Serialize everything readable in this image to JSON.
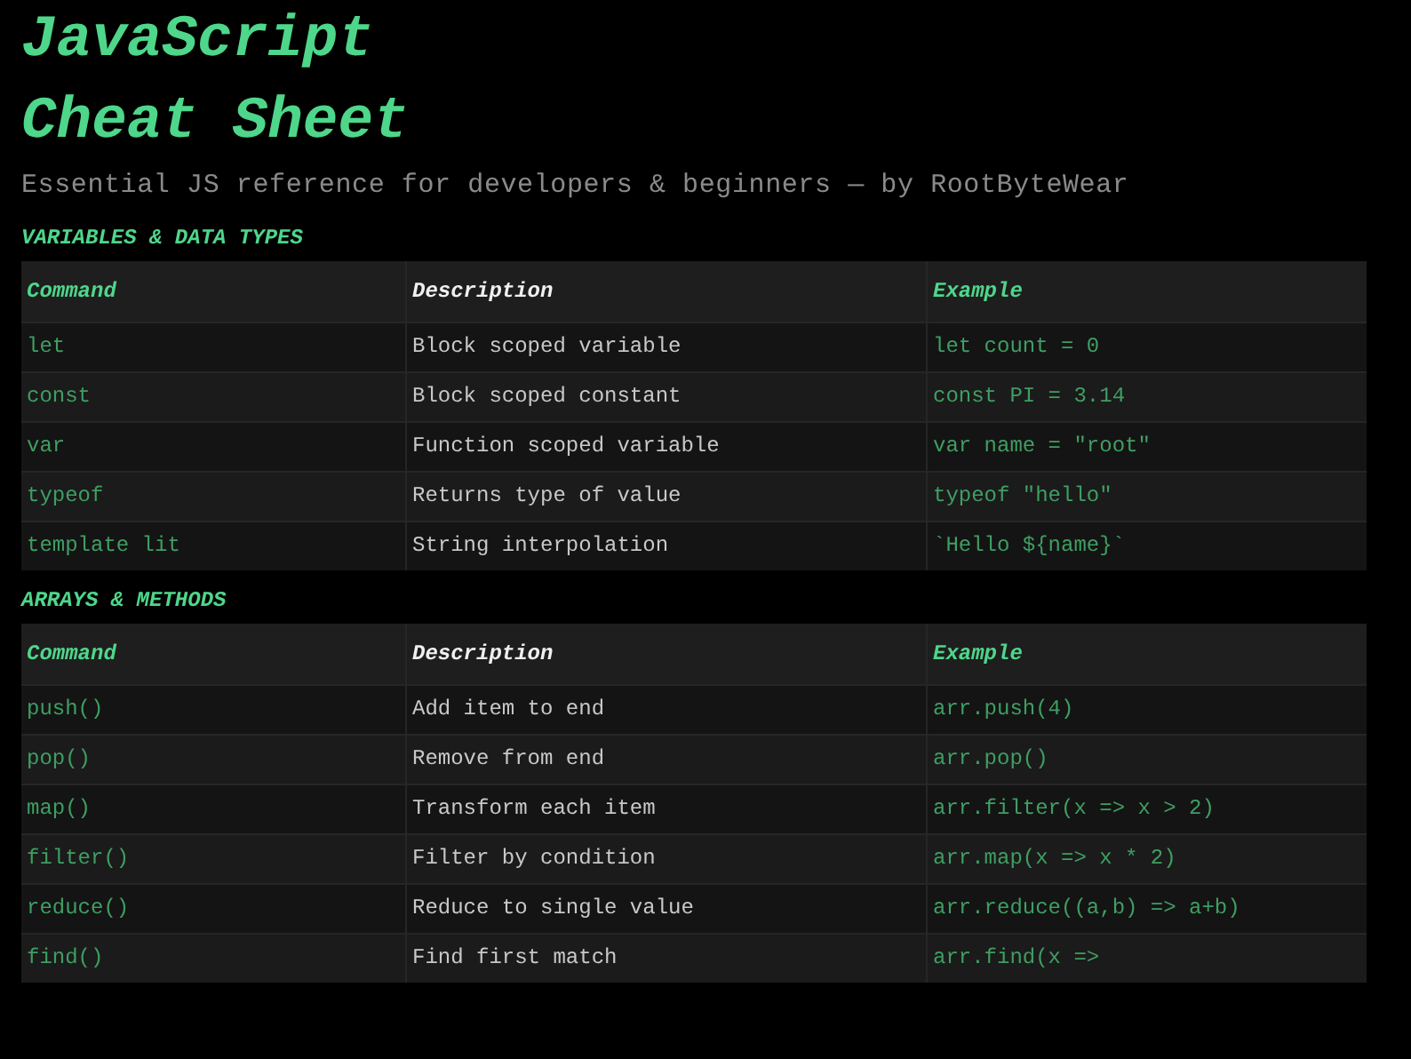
{
  "title": "JavaScript Cheat Sheet",
  "subtitle": "Essential JS reference for developers & beginners — by RootByteWear",
  "sections": [
    {
      "heading": "VARIABLES & DATA TYPES",
      "columns": [
        "Command",
        "Description",
        "Example"
      ],
      "rows": [
        [
          "let",
          "Block scoped variable",
          "let count = 0"
        ],
        [
          "const",
          "Block scoped constant",
          "const PI = 3.14"
        ],
        [
          "var",
          "Function scoped variable",
          "var name = \"root\""
        ],
        [
          "typeof",
          "Returns type of value",
          "typeof \"hello\""
        ],
        [
          "template lit",
          "String interpolation",
          "`Hello ${name}`"
        ]
      ]
    },
    {
      "heading": "ARRAYS & METHODS",
      "columns": [
        "Command",
        "Description",
        "Example"
      ],
      "rows": [
        [
          "push()",
          "Add item to end",
          "arr.push(4)"
        ],
        [
          "pop()",
          "Remove from end",
          "arr.pop()"
        ],
        [
          "map()",
          "Transform each item",
          "arr.filter(x => x > 2)"
        ],
        [
          "filter()",
          "Filter by condition",
          "arr.map(x => x * 2)"
        ],
        [
          "reduce()",
          "Reduce to single value",
          "arr.reduce((a,b) => a+b)"
        ],
        [
          "find()",
          "Find first match",
          "arr.find(x =>"
        ]
      ]
    }
  ]
}
